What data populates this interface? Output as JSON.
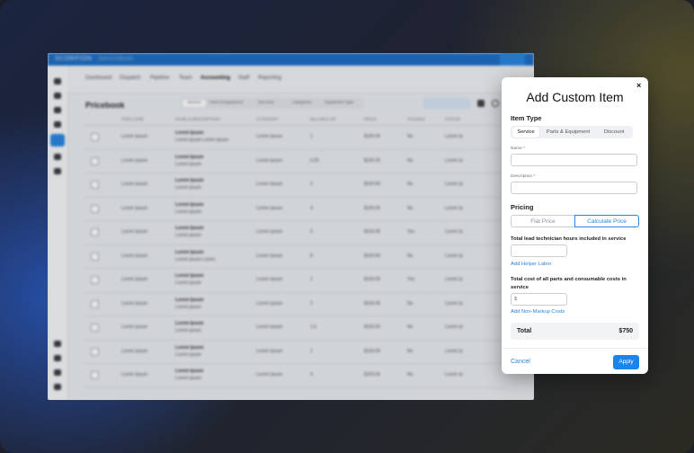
{
  "background_app": {
    "brand": "SCORPION",
    "brand_sub": "ServiceBook",
    "nav": [
      "Dashboard",
      "Dispatch",
      "Pipeline",
      "Team",
      "Accounting",
      "Staff",
      "Reporting"
    ],
    "nav_active": "Accounting",
    "page_title": "Pricebook",
    "segments": [
      "Service",
      "Parts & Equipment",
      "Discount",
      "Categories",
      "Equipment Type"
    ],
    "columns": [
      "ITEM CODE",
      "NAME & DESCRIPTION",
      "CATEGORY",
      "BILLABLE HR",
      "PRICE",
      "TAXABLE",
      "STATUS"
    ],
    "rows": [
      {
        "code": "Lorem Ipsum",
        "name": "Lorem Ipsum",
        "desc": "Lorem ipsum Lorem ipsum",
        "category": "Lorem Ipsum",
        "hours": "1",
        "price": "$100.00",
        "taxable": "No",
        "status": "Lorem Ip"
      },
      {
        "code": "Lorem Ipsum",
        "name": "Lorem Ipsum",
        "desc": "Lorem ipsum",
        "category": "Lorem Ipsum",
        "hours": "0.25",
        "price": "$100.00",
        "taxable": "No",
        "status": "Lorem Ip"
      },
      {
        "code": "Lorem Ipsum",
        "name": "Lorem Ipsum",
        "desc": "Lorem ipsum",
        "category": "Lorem Ipsum",
        "hours": "2",
        "price": "$100.00",
        "taxable": "No",
        "status": "Lorem Ip"
      },
      {
        "code": "Lorem Ipsum",
        "name": "Lorem Ipsum",
        "desc": "Lorem ipsum",
        "category": "Lorem Ipsum",
        "hours": "4",
        "price": "$100.00",
        "taxable": "No",
        "status": "Lorem Ip"
      },
      {
        "code": "Lorem Ipsum",
        "name": "Lorem Ipsum",
        "desc": "Lorem ipsum",
        "category": "Lorem Ipsum",
        "hours": "5",
        "price": "$100.00",
        "taxable": "Yes",
        "status": "Lorem Ip"
      },
      {
        "code": "Lorem Ipsum",
        "name": "Lorem Ipsum",
        "desc": "Lorem ipsum Lorem",
        "category": "Lorem Ipsum",
        "hours": "8",
        "price": "$100.00",
        "taxable": "No",
        "status": "Lorem Ip"
      },
      {
        "code": "Lorem Ipsum",
        "name": "Lorem Ipsum",
        "desc": "Lorem ipsum",
        "category": "Lorem Ipsum",
        "hours": "1",
        "price": "$100.00",
        "taxable": "Yes",
        "status": "Lorem Ip"
      },
      {
        "code": "Lorem Ipsum",
        "name": "Lorem Ipsum",
        "desc": "Lorem ipsum",
        "category": "Lorem Ipsum",
        "hours": "2",
        "price": "$100.00",
        "taxable": "No",
        "status": "Lorem Ip"
      },
      {
        "code": "Lorem Ipsum",
        "name": "Lorem Ipsum",
        "desc": "Lorem ipsum",
        "category": "Lorem Ipsum",
        "hours": "1.5",
        "price": "$100.00",
        "taxable": "No",
        "status": "Lorem Ip"
      },
      {
        "code": "Lorem Ipsum",
        "name": "Lorem Ipsum",
        "desc": "Lorem ipsum",
        "category": "Lorem Ipsum",
        "hours": "1",
        "price": "$100.00",
        "taxable": "No",
        "status": "Lorem Ip"
      },
      {
        "code": "Lorem Ipsum",
        "name": "Lorem Ipsum",
        "desc": "Lorem ipsum",
        "category": "Lorem Ipsum",
        "hours": "4",
        "price": "$100.00",
        "taxable": "No",
        "status": "Lorem Ip"
      }
    ]
  },
  "modal": {
    "title": "Add Custom Item",
    "close_glyph": "×",
    "item_type_label": "Item Type",
    "item_types": [
      "Service",
      "Parts & Equipment",
      "Discount"
    ],
    "item_type_selected": "Service",
    "name_label": "Name *",
    "name_value": "",
    "description_label": "Description *",
    "description_value": "",
    "pricing_label": "Pricing",
    "pricing_options": [
      "Flat Price",
      "Calculate Price"
    ],
    "pricing_selected": "Calculate Price",
    "hours_question": "Total lead technician hours included in service",
    "hours_value": "",
    "add_helper_labor": "Add Helper Labor",
    "costs_question": "Total cost of all parts and consumable costs in service",
    "costs_placeholder": "$",
    "add_non_markup": "Add Non-Markup Costs",
    "total_label": "Total",
    "total_value": "$750",
    "cancel_label": "Cancel",
    "apply_label": "Apply"
  },
  "colors": {
    "accent": "#1a84ea",
    "topbar": "#1f6fc4"
  }
}
